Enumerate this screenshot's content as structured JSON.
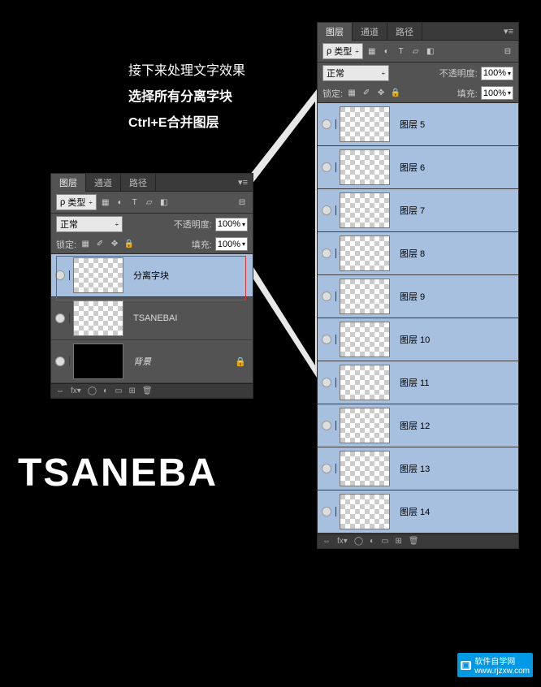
{
  "instruction": {
    "line1": "接下来处理文字效果",
    "line2": "选择所有分离字块",
    "line3": "Ctrl+E合并图层"
  },
  "art_text": "TSANEBA",
  "tabs": {
    "layers": "图层",
    "channels": "通道",
    "paths": "路径"
  },
  "filter_label": "类型",
  "blend_mode": "正常",
  "opacity_label": "不透明度:",
  "opacity_value": "100%",
  "lock_label": "锁定:",
  "fill_label": "填充:",
  "fill_value": "100%",
  "small_panel": {
    "layers": [
      {
        "name": "分离字块",
        "selected": true,
        "thumb": "trans"
      },
      {
        "name": "TSANEBAI",
        "selected": false,
        "thumb": "trans"
      },
      {
        "name": "背景",
        "selected": false,
        "thumb": "black",
        "italic": true,
        "locked": true
      }
    ]
  },
  "large_panel": {
    "layers": [
      {
        "name": "图层 5"
      },
      {
        "name": "图层 6"
      },
      {
        "name": "图层 7"
      },
      {
        "name": "图层 8"
      },
      {
        "name": "图层 9"
      },
      {
        "name": "图层 10"
      },
      {
        "name": "图层 11"
      },
      {
        "name": "图层 12"
      },
      {
        "name": "图层 13"
      },
      {
        "name": "图层 14"
      }
    ]
  },
  "watermark": {
    "brand": "软件自学网",
    "url": "www.rjzxw.com"
  }
}
